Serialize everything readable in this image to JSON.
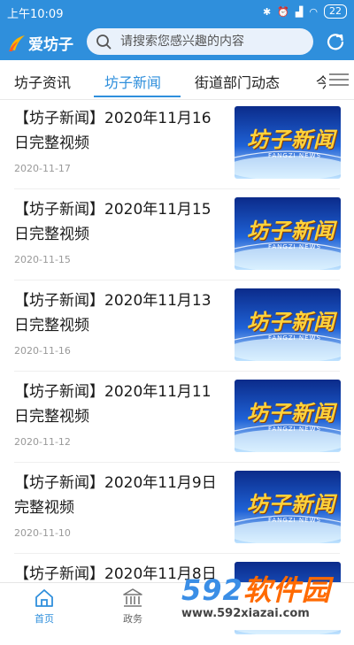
{
  "status_bar": {
    "time": "上午10:09",
    "battery": "22"
  },
  "app_bar": {
    "app_name": "爱坊子",
    "search_placeholder": "请搜索您感兴趣的内容"
  },
  "tabs": [
    {
      "label": "坊子资讯",
      "active": false
    },
    {
      "label": "坊子新闻",
      "active": true
    },
    {
      "label": "街道部门动态",
      "active": false
    },
    {
      "label": "今",
      "active": false
    }
  ],
  "news": [
    {
      "title": "【坊子新闻】2020年11月16日完整视频",
      "date": "2020-11-17"
    },
    {
      "title": "【坊子新闻】2020年11月15日完整视频",
      "date": "2020-11-15"
    },
    {
      "title": "【坊子新闻】2020年11月13日完整视频",
      "date": "2020-11-16"
    },
    {
      "title": "【坊子新闻】2020年11月11日完整视频",
      "date": "2020-11-12"
    },
    {
      "title": "【坊子新闻】2020年11月9日完整视频",
      "date": "2020-11-10"
    },
    {
      "title": "【坊子新闻】2020年11月8日",
      "date": ""
    }
  ],
  "thumbnail": {
    "title": "坊子新闻",
    "subtitle": "FANGZI NEWS"
  },
  "bottom_nav": [
    {
      "label": "首页",
      "icon": "home-icon",
      "active": true
    },
    {
      "label": "政务",
      "icon": "government-icon",
      "active": false
    }
  ],
  "watermark": {
    "brand_digits": "592",
    "brand_text": "软件园",
    "url": "www.592xiazai.com"
  },
  "colors": {
    "accent": "#2f8fdc",
    "text": "#1a1a1a",
    "date": "#999999"
  }
}
